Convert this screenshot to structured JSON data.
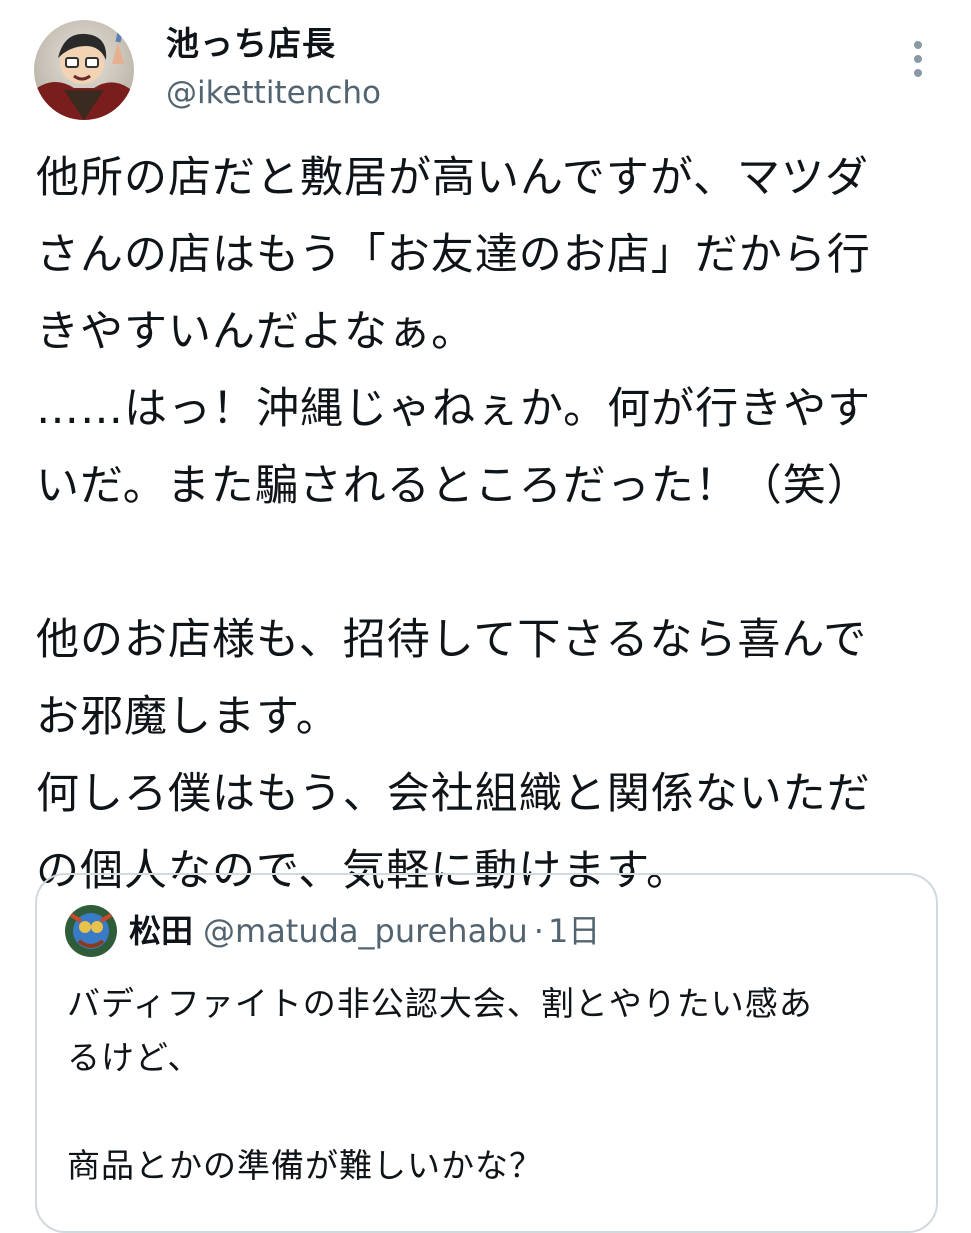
{
  "author": {
    "name": "池っち店長",
    "handle": "@ikettitencho"
  },
  "icons": {
    "more": "vertical-dots-icon",
    "avatar": "user-avatar"
  },
  "tweet": {
    "lines": [
      "他所の店だと敷居が高いんですが、マツダ",
      "さんの店はもう「お友達のお店」だから行",
      "きやすいんだよなぁ。",
      "……はっ！沖縄じゃねぇか。何が行きやす",
      "いだ。また騙されるところだった！（笑）",
      "",
      "他のお店様も、招待して下さるなら喜んで",
      "お邪魔します。",
      "何しろ僕はもう、会社組織と関係ないただ",
      "の個人なので、気軽に動けます。"
    ]
  },
  "quote": {
    "name": "松田",
    "handle": "@matuda_purehabu",
    "separator": "·",
    "time": "1日",
    "lines": [
      "バディファイトの非公認大会、割とやりたい感あ",
      "るけど、",
      "",
      "商品とかの準備が難しいかな？"
    ]
  },
  "colors": {
    "text": "#0f1419",
    "secondary": "#536471",
    "border": "#cfd9de"
  }
}
